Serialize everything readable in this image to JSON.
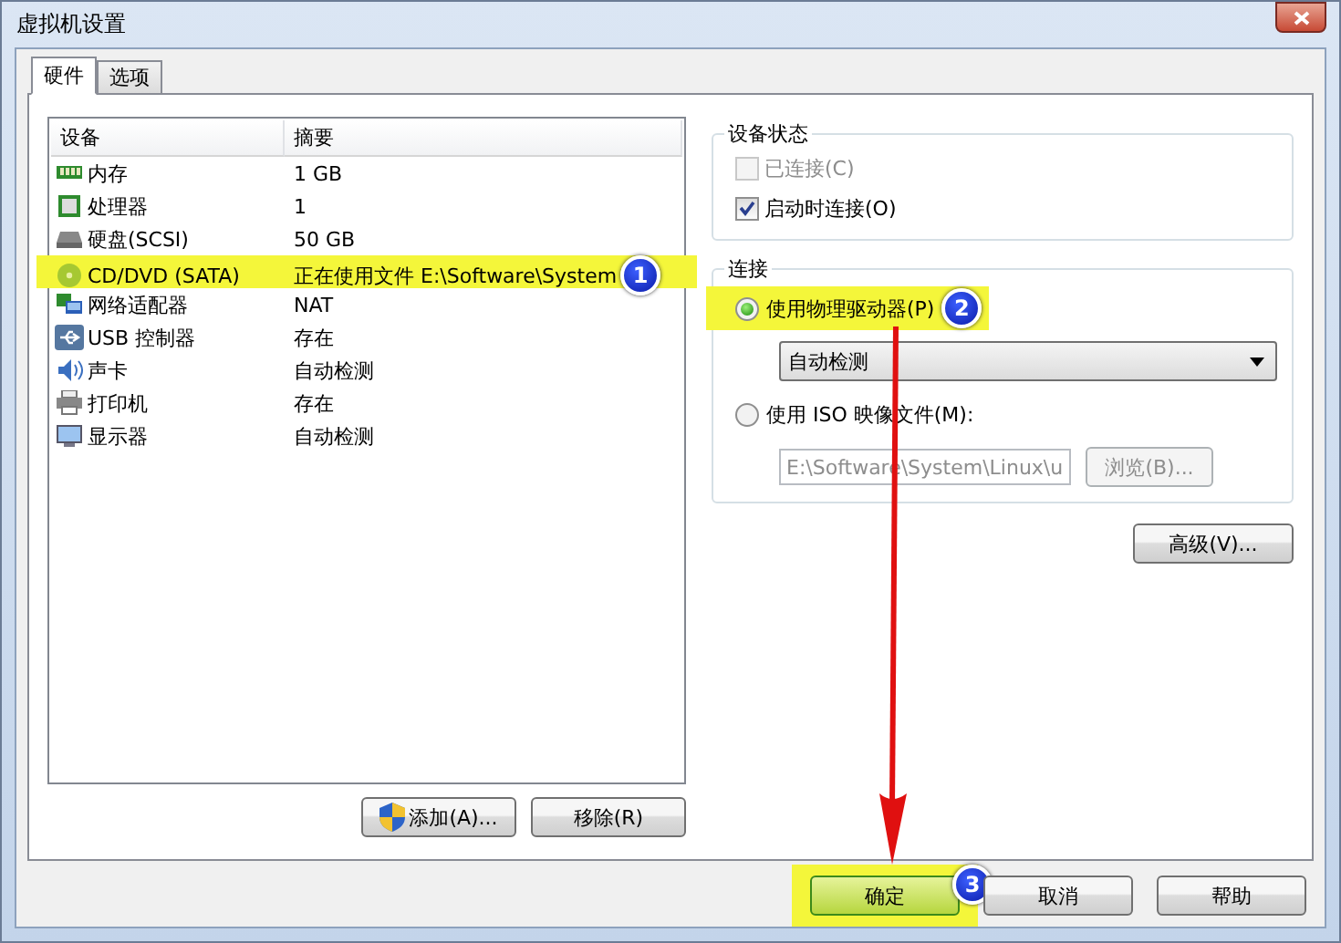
{
  "window": {
    "title": "虚拟机设置"
  },
  "tabs": [
    {
      "label": "硬件",
      "selected": true
    },
    {
      "label": "选项",
      "selected": false
    }
  ],
  "device_table": {
    "columns": [
      "设备",
      "摘要"
    ],
    "rows": [
      {
        "device": "内存",
        "summary": "1 GB",
        "highlighted": false
      },
      {
        "device": "处理器",
        "summary": "1",
        "highlighted": false
      },
      {
        "device": "硬盘(SCSI)",
        "summary": "50 GB",
        "highlighted": false
      },
      {
        "device": "CD/DVD (SATA)",
        "summary": "正在使用文件 E:\\Software\\System",
        "highlighted": true,
        "badge": "1"
      },
      {
        "device": "网络适配器",
        "summary": "NAT",
        "highlighted": false
      },
      {
        "device": "USB 控制器",
        "summary": "存在",
        "highlighted": false
      },
      {
        "device": "声卡",
        "summary": "自动检测",
        "highlighted": false
      },
      {
        "device": "打印机",
        "summary": "存在",
        "highlighted": false
      },
      {
        "device": "显示器",
        "summary": "自动检测",
        "highlighted": false
      }
    ]
  },
  "list_buttons": [
    {
      "label": "添加(A)...",
      "shield": true
    },
    {
      "label": "移除(R)",
      "shield": false
    }
  ],
  "device_status": {
    "title": "设备状态",
    "checkboxes": [
      {
        "label": "已连接(C)",
        "checked": false,
        "disabled": true
      },
      {
        "label": "启动时连接(O)",
        "checked": true,
        "disabled": false
      }
    ]
  },
  "connection": {
    "title": "连接",
    "physical_option": {
      "label": "使用物理驱动器(P)",
      "selected": true,
      "highlighted": true,
      "badge": "2"
    },
    "drive_select": {
      "value": "自动检测"
    },
    "iso_option": {
      "label": "使用 ISO 映像文件(M):",
      "selected": false,
      "highlighted": false
    },
    "iso_path": {
      "value": "E:\\Software\\System\\Linux\\u",
      "disabled": true
    },
    "browse_button": {
      "label": "浏览(B)...",
      "disabled": true
    }
  },
  "advanced_button": {
    "label": "高级(V)..."
  },
  "footer_buttons": [
    {
      "label": "确定",
      "highlighted": true,
      "badge": "3"
    },
    {
      "label": "取消",
      "highlighted": false
    },
    {
      "label": "帮助",
      "highlighted": false
    }
  ]
}
